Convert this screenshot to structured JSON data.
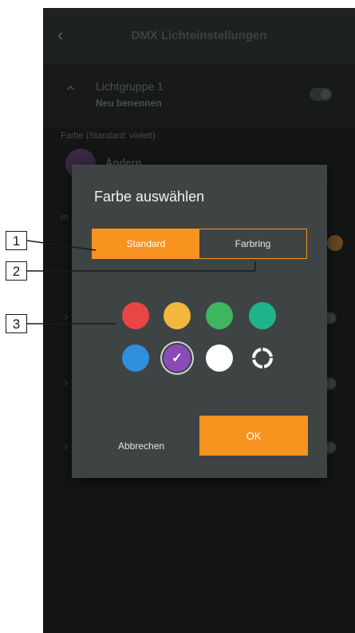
{
  "header": {
    "title": "DMX Lichteinstellungen",
    "back_icon": "chevron-left-icon"
  },
  "group": {
    "name": "Lichtgruppe 1",
    "rename_label": "Neu benennen"
  },
  "color_setting": {
    "label": "Farbe (Standard: violett)",
    "change_label": "Ändern",
    "current_color": "#7b3fa0"
  },
  "intensity": {
    "label_fragment": "In"
  },
  "dialog": {
    "title": "Farbe auswählen",
    "tabs": [
      {
        "label": "Standard",
        "active": true
      },
      {
        "label": "Farbring",
        "active": false
      }
    ],
    "colors": [
      {
        "name": "red",
        "hex": "#e84545"
      },
      {
        "name": "yellow",
        "hex": "#f3b73e"
      },
      {
        "name": "green",
        "hex": "#3fb561"
      },
      {
        "name": "teal",
        "hex": "#1fb58b"
      },
      {
        "name": "blue",
        "hex": "#2f8fdc"
      },
      {
        "name": "violet",
        "hex": "#8a4bb8",
        "selected": true
      },
      {
        "name": "white",
        "hex": "#ffffff"
      },
      {
        "name": "custom",
        "icon": "color-ring-icon"
      }
    ],
    "cancel_label": "Abbrechen",
    "ok_label": "OK"
  },
  "callouts": [
    "1",
    "2",
    "3"
  ],
  "theme": {
    "accent": "#f7931e",
    "dialog_bg": "#3e4444",
    "screen_bg": "#141515"
  }
}
